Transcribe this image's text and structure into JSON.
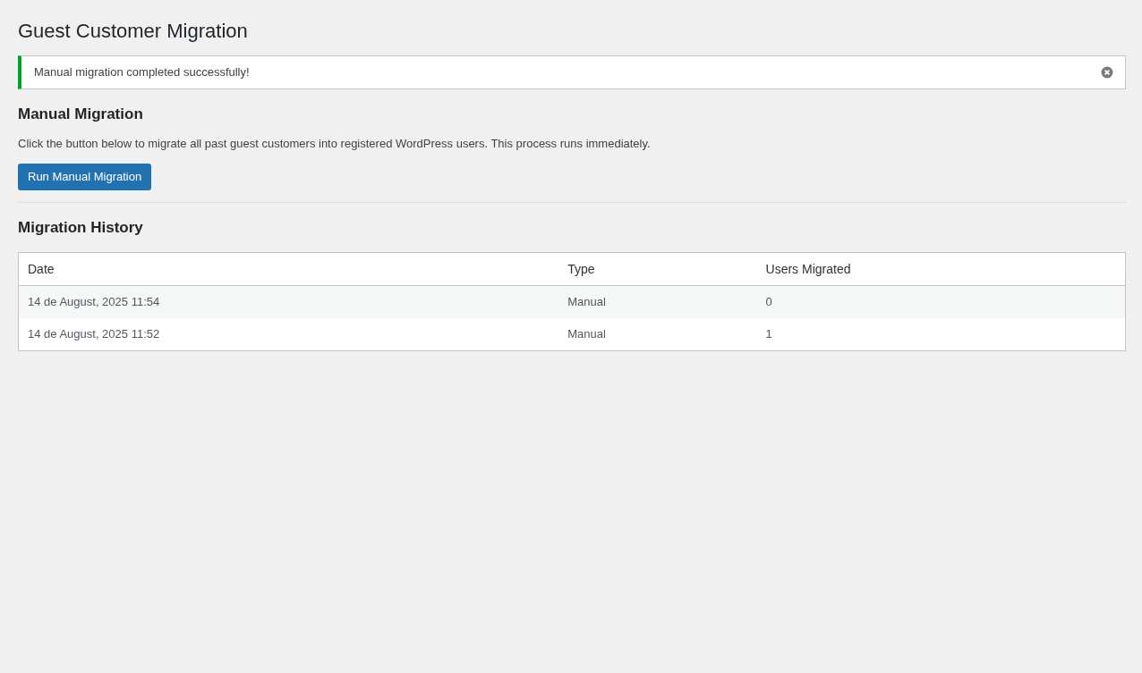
{
  "page_title": "Guest Customer Migration",
  "notice": {
    "message": "Manual migration completed successfully!",
    "dismissible": true
  },
  "manual_section": {
    "heading": "Manual Migration",
    "description": "Click the button below to migrate all past guest customers into registered WordPress users. This process runs immediately.",
    "button": "Run Manual Migration"
  },
  "history": {
    "heading": "Migration History",
    "columns": [
      "Date",
      "Type",
      "Users Migrated"
    ],
    "rows": [
      {
        "date": "14 de August, 2025 11:54",
        "type": "Manual",
        "users_migrated": "0"
      },
      {
        "date": "14 de August, 2025 11:52",
        "type": "Manual",
        "users_migrated": "1"
      }
    ]
  }
}
